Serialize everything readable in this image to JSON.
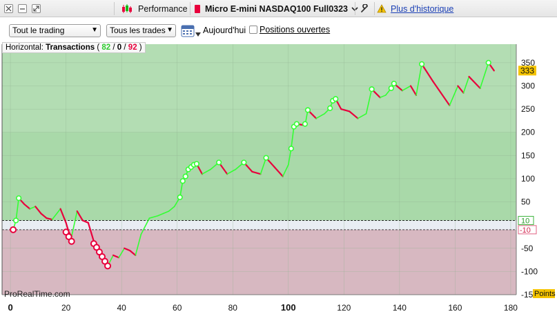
{
  "toolbar": {
    "performance_label": "Performance",
    "instrument": "Micro E-mini NASDAQ100 Full0323",
    "history_link": "Plus d'historique"
  },
  "filters": {
    "trading_select": "Tout le trading",
    "trades_select": "Tous les trades",
    "date_label": "Aujourd'hui",
    "open_positions_label": "Positions ouvertes"
  },
  "horizontal": {
    "prefix": "Horizontal:",
    "label": "Transactions",
    "open_paren": "(",
    "wins": "82",
    "sep1": "/",
    "neutral": "0",
    "sep2": "/",
    "total": "92",
    "close_paren": ")"
  },
  "watermark": "ProRealTime.com",
  "chart_data": {
    "type": "line",
    "xlim": [
      -3,
      182
    ],
    "ylim": [
      -150,
      390
    ],
    "x_ticks": [
      "0",
      "20",
      "40",
      "60",
      "80",
      "100",
      "120",
      "140",
      "160",
      "180"
    ],
    "x_tick_values": [
      0,
      20,
      40,
      60,
      80,
      100,
      120,
      140,
      160,
      180
    ],
    "y_ticks": [
      "350",
      "300",
      "250",
      "200",
      "150",
      "100",
      "50",
      "-50",
      "-100",
      "-15"
    ],
    "y_tick_values": [
      350,
      300,
      250,
      200,
      150,
      100,
      50,
      -50,
      -100,
      -150
    ],
    "current_value": "333",
    "upper_threshold": "10",
    "lower_threshold": "-10",
    "unit_label": "Points",
    "colors": {
      "win": "#33ff33",
      "loss": "#e8003c",
      "positive_bg": "#a3d8a3",
      "negative_bg": "#d9b9c2"
    },
    "points": [
      [
        1,
        -10
      ],
      [
        2,
        10
      ],
      [
        3,
        58
      ],
      [
        5,
        45
      ],
      [
        7,
        35
      ],
      [
        9,
        40
      ],
      [
        11,
        25
      ],
      [
        13,
        15
      ],
      [
        15,
        12
      ],
      [
        18,
        35
      ],
      [
        20,
        5
      ],
      [
        21,
        -15
      ],
      [
        22,
        -25
      ],
      [
        24,
        30
      ],
      [
        26,
        10
      ],
      [
        28,
        5
      ],
      [
        30,
        -35
      ],
      [
        31,
        -45
      ],
      [
        32,
        -55
      ],
      [
        33,
        -65
      ],
      [
        34,
        -75
      ],
      [
        35,
        -88
      ],
      [
        37,
        -65
      ],
      [
        39,
        -70
      ],
      [
        41,
        -50
      ],
      [
        43,
        -55
      ],
      [
        45,
        -65
      ],
      [
        47,
        -20
      ],
      [
        50,
        15
      ],
      [
        53,
        20
      ],
      [
        55,
        25
      ],
      [
        57,
        30
      ],
      [
        59,
        40
      ],
      [
        61,
        60
      ],
      [
        62,
        95
      ],
      [
        63,
        105
      ],
      [
        64,
        120
      ],
      [
        65,
        125
      ],
      [
        66,
        130
      ],
      [
        67,
        132
      ],
      [
        69,
        110
      ],
      [
        72,
        120
      ],
      [
        75,
        135
      ],
      [
        78,
        110
      ],
      [
        81,
        120
      ],
      [
        84,
        135
      ],
      [
        87,
        115
      ],
      [
        90,
        110
      ],
      [
        92,
        145
      ],
      [
        95,
        125
      ],
      [
        98,
        105
      ],
      [
        100,
        130
      ],
      [
        101,
        165
      ],
      [
        102,
        212
      ],
      [
        103,
        218
      ],
      [
        106,
        215
      ],
      [
        107,
        248
      ],
      [
        110,
        230
      ],
      [
        113,
        240
      ],
      [
        115,
        252
      ],
      [
        116,
        268
      ],
      [
        117,
        272
      ],
      [
        119,
        250
      ],
      [
        122,
        245
      ],
      [
        125,
        230
      ],
      [
        128,
        240
      ],
      [
        130,
        293
      ],
      [
        133,
        275
      ],
      [
        135,
        280
      ],
      [
        137,
        295
      ],
      [
        138,
        305
      ],
      [
        141,
        290
      ],
      [
        144,
        300
      ],
      [
        146,
        280
      ],
      [
        148,
        347
      ],
      [
        152,
        310
      ],
      [
        158,
        258
      ],
      [
        161,
        300
      ],
      [
        163,
        285
      ],
      [
        165,
        320
      ],
      [
        169,
        295
      ],
      [
        172,
        350
      ],
      [
        174,
        333
      ]
    ],
    "markers": [
      [
        1,
        -10,
        "loss"
      ],
      [
        2,
        10,
        "win"
      ],
      [
        3,
        58,
        "win"
      ],
      [
        20,
        -15,
        "loss"
      ],
      [
        21,
        -25,
        "loss"
      ],
      [
        22,
        -35,
        "loss"
      ],
      [
        30,
        -40,
        "loss"
      ],
      [
        31,
        -48,
        "loss"
      ],
      [
        32,
        -58,
        "loss"
      ],
      [
        33,
        -68,
        "loss"
      ],
      [
        34,
        -78,
        "loss"
      ],
      [
        35,
        -88,
        "loss"
      ],
      [
        61,
        60,
        "win"
      ],
      [
        62,
        95,
        "win"
      ],
      [
        63,
        105,
        "win"
      ],
      [
        64,
        120,
        "win"
      ],
      [
        65,
        125,
        "win"
      ],
      [
        66,
        130,
        "win"
      ],
      [
        67,
        132,
        "win"
      ],
      [
        75,
        135,
        "win"
      ],
      [
        84,
        135,
        "win"
      ],
      [
        92,
        145,
        "win"
      ],
      [
        101,
        165,
        "win"
      ],
      [
        102,
        212,
        "win"
      ],
      [
        103,
        218,
        "win"
      ],
      [
        106,
        218,
        "win"
      ],
      [
        107,
        248,
        "win"
      ],
      [
        115,
        252,
        "win"
      ],
      [
        116,
        268,
        "win"
      ],
      [
        117,
        272,
        "win"
      ],
      [
        130,
        293,
        "win"
      ],
      [
        137,
        295,
        "win"
      ],
      [
        138,
        305,
        "win"
      ],
      [
        148,
        347,
        "win"
      ],
      [
        172,
        350,
        "win"
      ]
    ]
  }
}
